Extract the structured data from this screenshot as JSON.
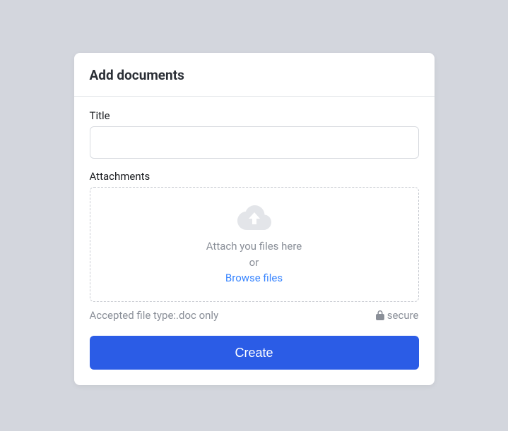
{
  "header": {
    "title": "Add documents"
  },
  "form": {
    "title_label": "Title",
    "title_value": "",
    "attachments_label": "Attachments",
    "dropzone": {
      "primary_text": "Attach you files here",
      "or_text": "or",
      "browse_link": "Browse files"
    },
    "hint_text": "Accepted file type:.doc only",
    "secure_label": "secure",
    "submit_label": "Create"
  },
  "icons": {
    "cloud_upload": "cloud-upload-icon",
    "lock": "lock-icon"
  },
  "colors": {
    "primary": "#2b5ce6",
    "link": "#3a86ff",
    "muted": "#8a8f98",
    "border": "#d8dbe0",
    "bg": "#d3d6dd"
  }
}
